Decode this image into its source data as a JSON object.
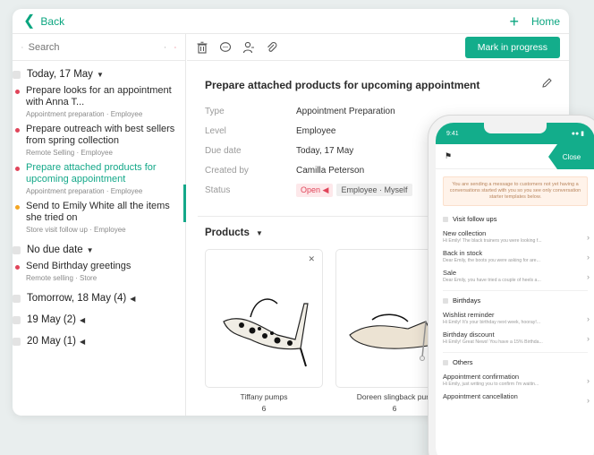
{
  "topbar": {
    "back_label": "Back",
    "home_label": "Home"
  },
  "sidebar": {
    "search_placeholder": "Search",
    "groups": [
      {
        "label": "Today, 17 May",
        "tasks": [
          {
            "title": "Prepare looks for an appointment with Anna T...",
            "sub": "Appointment preparation · Employee",
            "dot": "#e0455a"
          },
          {
            "title": "Prepare outreach with best sellers from spring collection",
            "sub": "Remote Selling · Employee",
            "dot": "#e0455a"
          },
          {
            "title": "Prepare attached products for upcoming appointment",
            "sub": "Appointment preparation · Employee",
            "dot": "#e0455a"
          },
          {
            "title": "Send to Emily White all the items she tried on",
            "sub": "Store visit follow up · Employee",
            "dot": "#f4a623"
          }
        ]
      },
      {
        "label": "No due date",
        "tasks": [
          {
            "title": "Send Birthday greetings",
            "sub": "Remote selling · Store",
            "dot": "#e0455a"
          }
        ]
      },
      {
        "label": "Tomorrow, 18 May (4)"
      },
      {
        "label": "19 May (2)"
      },
      {
        "label": "20 May (1)"
      }
    ]
  },
  "toolbar": {
    "mark_label": "Mark in progress"
  },
  "detail": {
    "title": "Prepare attached products for upcoming appointment",
    "fields": [
      {
        "label": "Type",
        "value": "Appointment Preparation"
      },
      {
        "label": "Level",
        "value": "Employee"
      },
      {
        "label": "Due date",
        "value": "Today, 17 May"
      },
      {
        "label": "Created by",
        "value": "Camilla Peterson"
      }
    ],
    "status_label": "Status",
    "status_open": "Open",
    "status_assignee": "Employee · Myself",
    "products_label": "Products",
    "products": [
      {
        "name": "Tiffany pumps",
        "qty": "6"
      },
      {
        "name": "Doreen slingback pum",
        "qty": "6"
      }
    ]
  },
  "phone": {
    "time": "9:41",
    "close_label": "Close",
    "notice": "You are sending a message to customers not yet having a conversations started with you so you see only conversation starter templates below.",
    "groups": [
      {
        "label": "Visit follow ups",
        "items": [
          {
            "name": "New collection",
            "preview": "Hi Emily! The black trainers you were looking f..."
          },
          {
            "name": "Back in stock",
            "preview": "Dear Emily, the boots you were asking for are..."
          },
          {
            "name": "Sale",
            "preview": "Dear Emily, you have tried a couple of heels a..."
          }
        ]
      },
      {
        "label": "Birthdays",
        "items": [
          {
            "name": "Wishlist reminder",
            "preview": "Hi Emily! It's your birthday next week, hooray!..."
          },
          {
            "name": "Birthday discount",
            "preview": "Hi Emily! Great News! You have a 15% Birthda..."
          }
        ]
      },
      {
        "label": "Others",
        "items": [
          {
            "name": "Appointment confirmation",
            "preview": "Hi Emily, just writing you to confirm I'm waitin..."
          },
          {
            "name": "Appointment cancellation",
            "preview": ""
          }
        ]
      }
    ]
  }
}
